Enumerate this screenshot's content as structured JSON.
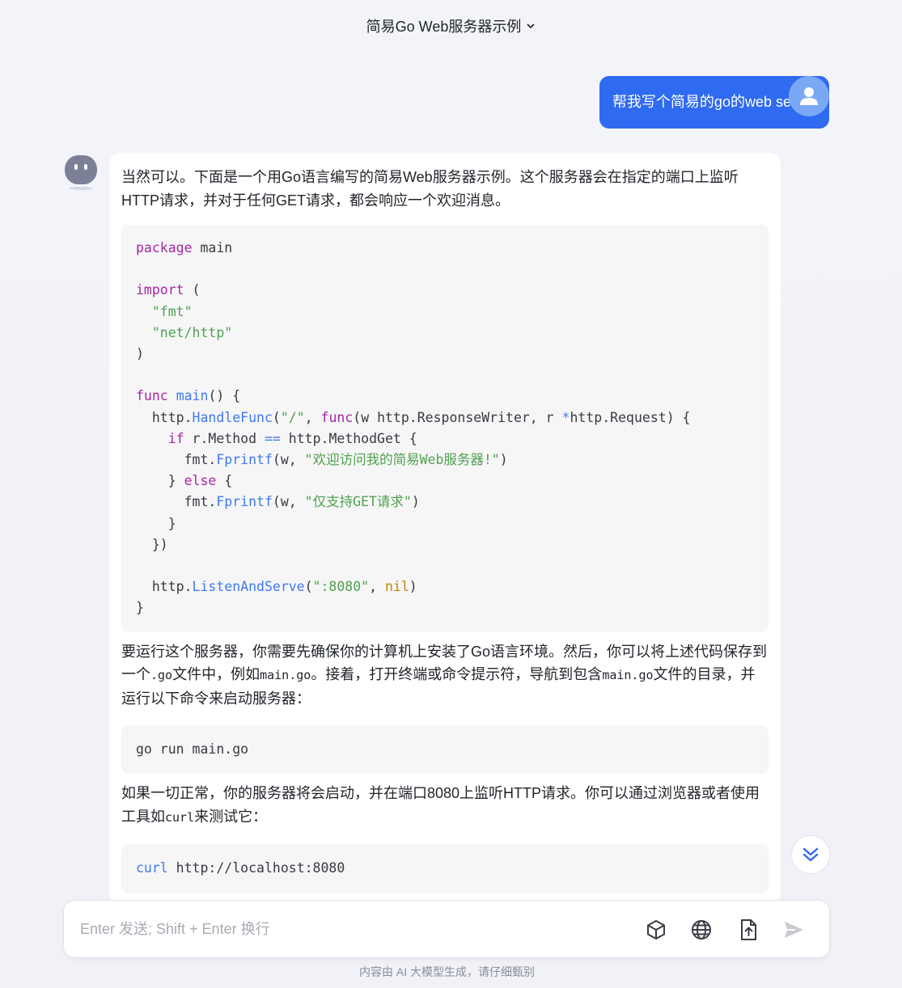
{
  "header": {
    "title": "简易Go Web服务器示例",
    "dropdown_icon": "chevron-down-icon"
  },
  "user_message": {
    "text": "帮我写个简易的go的web server",
    "avatar_icon": "user-icon"
  },
  "bot": {
    "avatar_icon": "bot-icon",
    "intro": "当然可以。下面是一个用Go语言编写的简易Web服务器示例。这个服务器会在指定的端口上监听HTTP请求，并对于任何GET请求，都会响应一个欢迎消息。",
    "code1": {
      "l1_kw": "package",
      "l1_rest": " main",
      "l3_kw": "import",
      "l3_rest": " (",
      "l4": "\"fmt\"",
      "l5": "\"net/http\"",
      "l6": ")",
      "l8_kw": "func",
      "l8_fn": "main",
      "l8_rest": "() {",
      "l9_a": "http.",
      "l9_fn": "HandleFunc",
      "l9_b": "(",
      "l9_str": "\"/\"",
      "l9_c": ", ",
      "l9_kw": "func",
      "l9_d": "(w http.ResponseWriter, r ",
      "l9_op": "*",
      "l9_e": "http.Request) {",
      "l10_kw": "if",
      "l10_a": " r.Method ",
      "l10_op": "==",
      "l10_b": " http.MethodGet {",
      "l11_a": "fmt.",
      "l11_fn": "Fprintf",
      "l11_b": "(w, ",
      "l11_str": "\"欢迎访问我的简易Web服务器!\"",
      "l11_c": ")",
      "l12_a": "} ",
      "l12_kw": "else",
      "l12_b": " {",
      "l13_a": "fmt.",
      "l13_fn": "Fprintf",
      "l13_b": "(w, ",
      "l13_str": "\"仅支持GET请求\"",
      "l13_c": ")",
      "l14": "}",
      "l15": "})",
      "l17_a": "http.",
      "l17_fn": "ListenAndServe",
      "l17_b": "(",
      "l17_str": "\":8080\"",
      "l17_c": ", ",
      "l17_lit": "nil",
      "l17_d": ")",
      "l18": "}"
    },
    "para2": {
      "a": "要运行这个服务器，你需要先确保你的计算机上安装了Go语言环境。然后，你可以将上述代码保存到一个",
      "code_a": ".go",
      "b": "文件中，例如",
      "code_b": "main.go",
      "c": "。接着，打开终端或命令提示符，导航到包含",
      "code_c": "main.go",
      "d": "文件的目录，并运行以下命令来启动服务器："
    },
    "code2": "go run main.go",
    "para3": {
      "a": "如果一切正常，你的服务器将会启动，并在端口8080上监听HTTP请求。你可以通过浏览器或者使用工具如",
      "code_a": "curl",
      "b": "来测试它："
    },
    "code3": {
      "kw": "curl",
      "rest": " http://localhost:8080"
    }
  },
  "scroll_button": {
    "icon": "double-chevron-down-icon"
  },
  "composer": {
    "placeholder": "Enter 发送; Shift + Enter 换行",
    "value": "",
    "tools": [
      "cube-icon",
      "globe-icon",
      "file-upload-icon",
      "send-icon"
    ]
  },
  "footer": {
    "disclaimer": "内容由 AI 大模型生成，请仔细甄别"
  }
}
